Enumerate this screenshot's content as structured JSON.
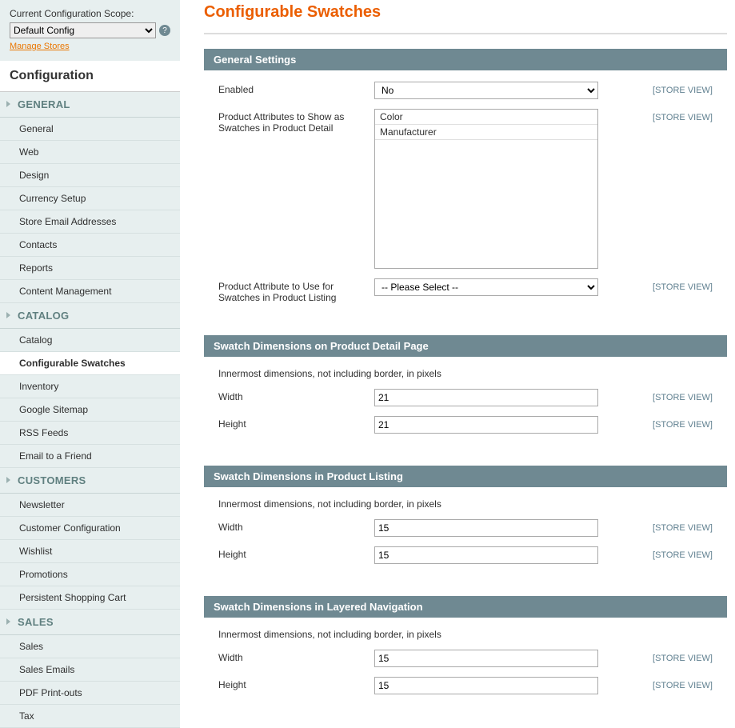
{
  "sidebar": {
    "scope_label": "Current Configuration Scope:",
    "scope_value": "Default Config",
    "manage_stores": "Manage Stores",
    "config_title": "Configuration",
    "sections": [
      {
        "title": "GENERAL",
        "items": [
          "General",
          "Web",
          "Design",
          "Currency Setup",
          "Store Email Addresses",
          "Contacts",
          "Reports",
          "Content Management"
        ]
      },
      {
        "title": "CATALOG",
        "items": [
          "Catalog",
          "Configurable Swatches",
          "Inventory",
          "Google Sitemap",
          "RSS Feeds",
          "Email to a Friend"
        ],
        "active": "Configurable Swatches"
      },
      {
        "title": "CUSTOMERS",
        "items": [
          "Newsletter",
          "Customer Configuration",
          "Wishlist",
          "Promotions",
          "Persistent Shopping Cart"
        ]
      },
      {
        "title": "SALES",
        "items": [
          "Sales",
          "Sales Emails",
          "PDF Print-outs",
          "Tax"
        ]
      }
    ]
  },
  "page": {
    "title": "Configurable Swatches",
    "scope_tag": "[STORE VIEW]",
    "general": {
      "header": "General Settings",
      "enabled_label": "Enabled",
      "enabled_value": "No",
      "attrs_detail_label": "Product Attributes to Show as Swatches in Product Detail",
      "attrs_detail_options": [
        "Color",
        "Manufacturer"
      ],
      "attr_listing_label": "Product Attribute to Use for Swatches in Product Listing",
      "attr_listing_value": "-- Please Select --"
    },
    "detail_dims": {
      "header": "Swatch Dimensions on Product Detail Page",
      "hint": "Innermost dimensions, not including border, in pixels",
      "width_label": "Width",
      "width_value": "21",
      "height_label": "Height",
      "height_value": "21"
    },
    "listing_dims": {
      "header": "Swatch Dimensions in Product Listing",
      "hint": "Innermost dimensions, not including border, in pixels",
      "width_label": "Width",
      "width_value": "15",
      "height_label": "Height",
      "height_value": "15"
    },
    "layered_dims": {
      "header": "Swatch Dimensions in Layered Navigation",
      "hint": "Innermost dimensions, not including border, in pixels",
      "width_label": "Width",
      "width_value": "15",
      "height_label": "Height",
      "height_value": "15"
    }
  }
}
